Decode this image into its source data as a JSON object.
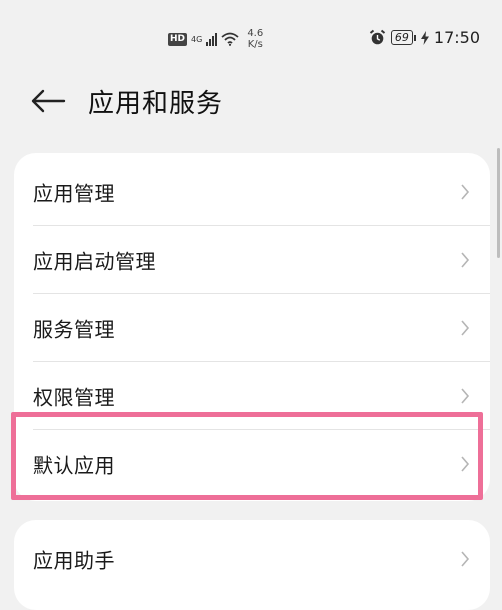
{
  "status_bar": {
    "hd": "HD",
    "network_type": "4G",
    "network_sub": "↑↓",
    "speed_value": "4.6",
    "speed_unit": "K/s",
    "battery": "69",
    "time": "17:50",
    "icons": [
      "signal-icon",
      "wifi-icon",
      "alarm-icon",
      "battery-icon",
      "charging-icon"
    ]
  },
  "header": {
    "title": "应用和服务",
    "back_icon": "back-arrow-icon"
  },
  "menu": {
    "items": [
      {
        "label": "应用管理"
      },
      {
        "label": "应用启动管理"
      },
      {
        "label": "服务管理"
      },
      {
        "label": "权限管理"
      },
      {
        "label": "默认应用",
        "highlighted": true
      }
    ]
  },
  "menu2": {
    "items": [
      {
        "label": "应用助手"
      }
    ]
  },
  "colors": {
    "background": "#f1f1f1",
    "card": "#ffffff",
    "highlight": "#ee6f98",
    "chevron": "#b5b5b5"
  }
}
